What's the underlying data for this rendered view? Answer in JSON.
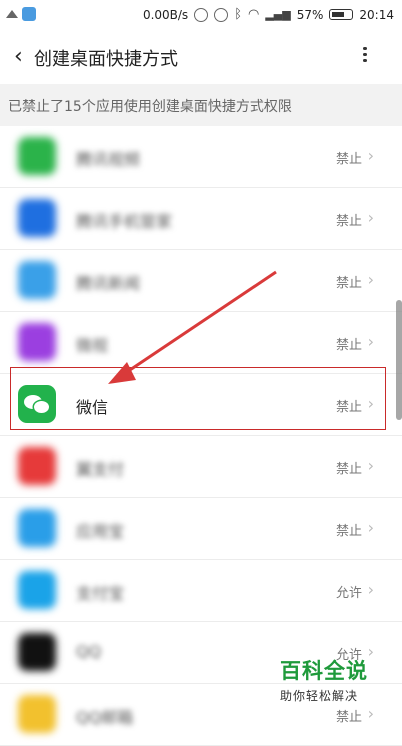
{
  "status_bar": {
    "network_speed": "0.00B/s",
    "battery_percent": "57%",
    "time": "20:14"
  },
  "header": {
    "title": "创建桌面快捷方式"
  },
  "subheader": {
    "text": "已禁止了15个应用使用创建桌面快捷方式权限"
  },
  "apps": [
    {
      "name": "腾讯视频",
      "status": "禁止",
      "icon_color": "#2bb34a",
      "blurred": true
    },
    {
      "name": "腾讯手机管家",
      "status": "禁止",
      "icon_color": "#1f6fe0",
      "blurred": true
    },
    {
      "name": "腾讯新闻",
      "status": "禁止",
      "icon_color": "#3aa0e8",
      "blurred": true
    },
    {
      "name": "微视",
      "status": "禁止",
      "icon_color": "#9b3fe0",
      "blurred": true
    },
    {
      "name": "微信",
      "status": "禁止",
      "icon_color": "#22b24c",
      "blurred": false
    },
    {
      "name": "翼支付",
      "status": "禁止",
      "icon_color": "#e63a3a",
      "blurred": true
    },
    {
      "name": "应用宝",
      "status": "禁止",
      "icon_color": "#2a9ee8",
      "blurred": true
    },
    {
      "name": "支付宝",
      "status": "允许",
      "icon_color": "#1aa3e8",
      "blurred": true
    },
    {
      "name": "QQ",
      "status": "允许",
      "icon_color": "#111111",
      "blurred": true
    },
    {
      "name": "QQ邮箱",
      "status": "禁止",
      "icon_color": "#f2c12e",
      "blurred": true
    }
  ],
  "watermark": {
    "main": "百科全说",
    "sub": "助你轻松解决"
  },
  "colors": {
    "highlight_border": "#c92a2a",
    "arrow": "#d93a3a",
    "watermark_green": "#1f9a3b"
  }
}
